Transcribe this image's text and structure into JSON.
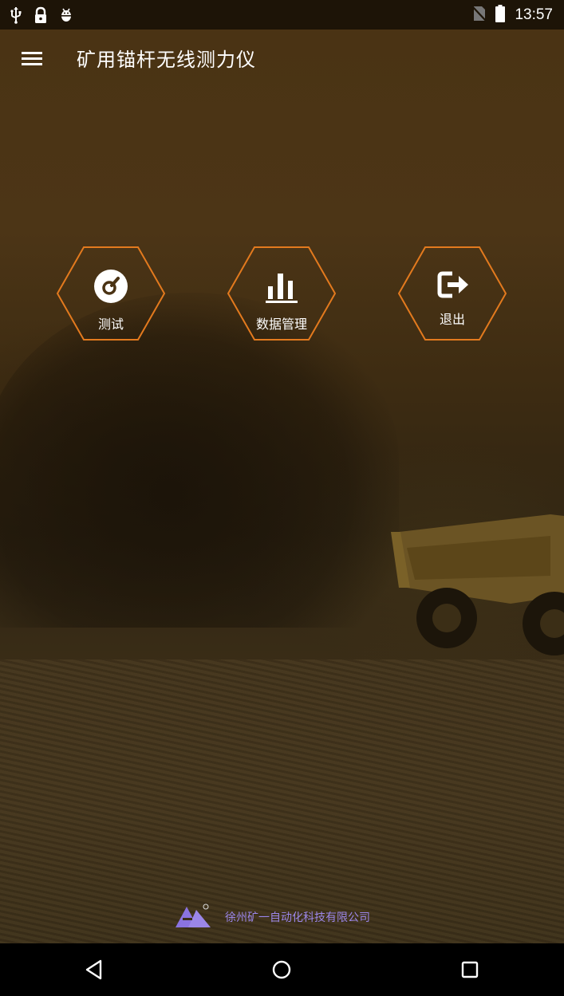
{
  "status_bar": {
    "time": "13:57",
    "left_icons": [
      "usb-icon",
      "lock-icon",
      "android-debug-icon"
    ],
    "right_icons": [
      "no-sim-icon",
      "battery-icon"
    ]
  },
  "toolbar": {
    "title": "矿用锚杆无线测力仪",
    "menu_icon": "hamburger-menu-icon"
  },
  "menu": {
    "items": [
      {
        "label": "测试",
        "icon": "gauge-icon"
      },
      {
        "label": "数据管理",
        "icon": "bar-chart-icon"
      },
      {
        "label": "退出",
        "icon": "logout-icon"
      }
    ]
  },
  "footer": {
    "company": "徐州矿一自动化科技有限公司",
    "logo": "company-logo",
    "brand_color": "#9b86e8"
  },
  "nav_bar": {
    "buttons": [
      "back-icon",
      "home-icon",
      "recents-icon"
    ]
  },
  "colors": {
    "accent": "#e37a1e",
    "status_bar_bg": "#1d1407",
    "nav_bar_bg": "#000000"
  }
}
